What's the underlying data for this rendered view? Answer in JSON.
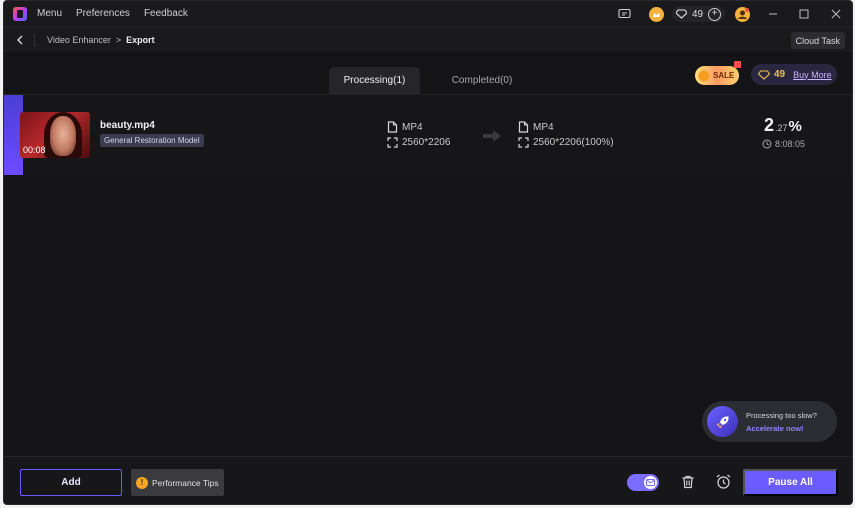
{
  "titlebar": {
    "menu_items": [
      "Menu",
      "Preferences",
      "Feedback"
    ],
    "credits": "49",
    "plus": "+"
  },
  "breadcrumb": {
    "parent": "Video Enhancer",
    "separator": ">",
    "current": "Export",
    "cloud_task": "Cloud Task"
  },
  "tabs": [
    {
      "label": "Processing(1)",
      "active": true
    },
    {
      "label": "Completed(0)",
      "active": false
    }
  ],
  "promo": {
    "sale_label": "SALE",
    "credits": "49",
    "buy_more": "Buy More"
  },
  "task": {
    "file_name": "beauty.mp4",
    "duration": "00:08",
    "model": "General Restoration Model",
    "input_format": "MP4",
    "input_resolution": "2560*2206",
    "output_format": "MP4",
    "output_resolution": "2560*2206(100%)",
    "progress_int": "2",
    "progress_dec": ".27",
    "progress_sign": "%",
    "progress_value": 2.27,
    "time_remaining": "8:08:05"
  },
  "toast": {
    "line1": "Processing too slow?",
    "line2": "Accelerate now!"
  },
  "bottombar": {
    "add_label": "Add",
    "performance_tips": "Performance Tips",
    "pause_all": "Pause All"
  },
  "colors": {
    "accent": "#6b5cff",
    "background": "#141416",
    "warning": "#f5a623"
  }
}
